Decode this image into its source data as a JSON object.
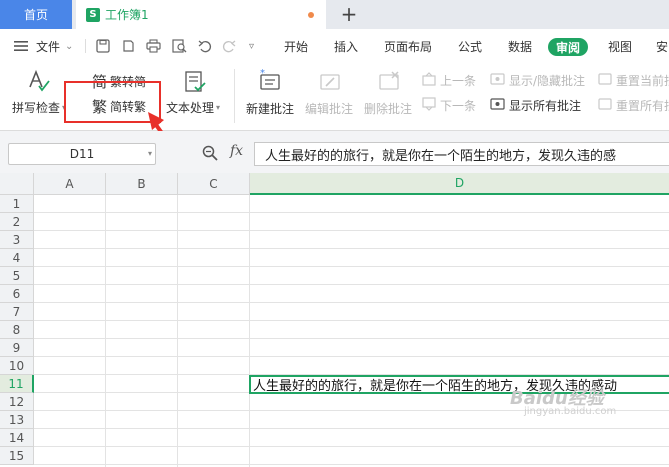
{
  "tabs": {
    "home_label": "首页",
    "doc_label": "工作簿1",
    "doc_badge": "S",
    "add_symbol": "+"
  },
  "menubar": {
    "hamburger_icon": "menu-icon",
    "file_label": "文件",
    "items": [
      "开始",
      "插入",
      "页面布局",
      "公式",
      "数据",
      "审阅",
      "视图",
      "安"
    ],
    "active_item": "审阅"
  },
  "ribbon": {
    "spell_check": "拼写检查",
    "trad_to_simp": "繁转简",
    "simp_to_trad": "简转繁",
    "text_processing": "文本处理",
    "new_comment": "新建批注",
    "edit_comment": "编辑批注",
    "delete_comment": "删除批注",
    "prev_item": "上一条",
    "next_item": "下一条",
    "show_hide_comments": "显示/隐藏批注",
    "show_all_comments": "显示所有批注",
    "reset_current": "重置当前批",
    "reset_all": "重置所有批"
  },
  "formula_bar": {
    "name_box": "D11",
    "fx": "fx",
    "content": "人生最好的的旅行，就是你在一个陌生的地方，发现久违的感"
  },
  "sheet": {
    "columns": [
      "A",
      "B",
      "C",
      "D"
    ],
    "rows": [
      "1",
      "2",
      "3",
      "4",
      "5",
      "6",
      "7",
      "8",
      "9",
      "10",
      "11",
      "12",
      "13",
      "14",
      "15"
    ],
    "active_cell_text": "人生最好的的旅行，就是你在一个陌生的地方，发现久违的感动",
    "active_row": "11",
    "active_col": "D"
  },
  "watermark": {
    "main": "Baidu经验",
    "sub": "jingyan.baidu.com"
  },
  "colors": {
    "accent_green": "#1fa463",
    "home_tab_blue": "#4a86e8",
    "highlight_red": "#e8302a"
  }
}
